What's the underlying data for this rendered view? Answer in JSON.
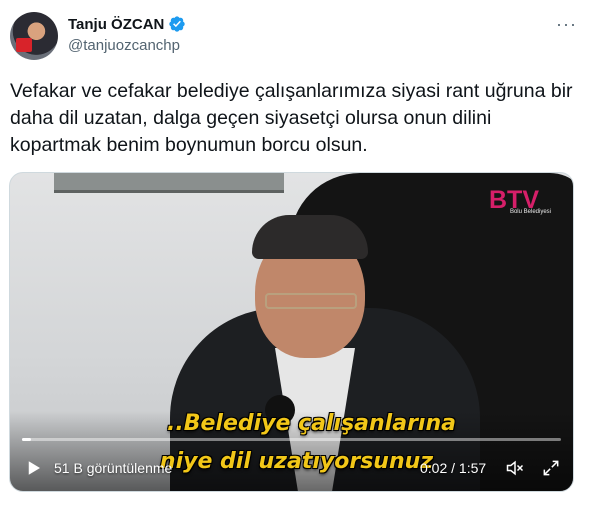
{
  "author": {
    "display_name": "Tanju ÖZCAN",
    "handle": "@tanjuozcanchp",
    "verified": true,
    "avatar_icon": "profile-photo"
  },
  "more_icon": "more-horizontal-icon",
  "tweet": {
    "text": "Vefakar ve cefakar belediye çalışanlarımıza siyasi rant uğruna bir daha dil uzatan, dalga geçen siyasetçi olursa onun dilini kopartmak benim boynumun borcu olsun."
  },
  "video": {
    "overlay_logo": "BTV",
    "overlay_logo_sub": "Bolu Belediyesi",
    "caption_line1": "..Belediye çalışanlarına",
    "caption_line2": "niye dil uzatıyorsunuz",
    "views_label": "51 B görüntülenme",
    "timecode": "0:02 / 1:57",
    "progress": 0.017,
    "colors": {
      "caption": "#f2c718",
      "logo": "#d61f69",
      "verified": "#1d9bf0"
    }
  }
}
